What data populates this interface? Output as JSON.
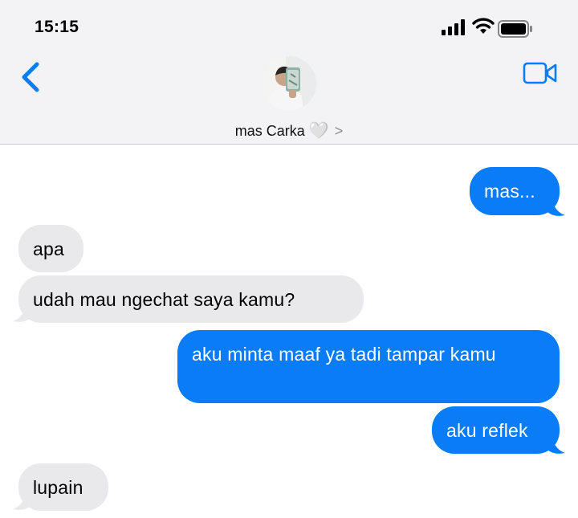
{
  "status_bar": {
    "time": "15:15",
    "icons": [
      "signal-icon",
      "wifi-icon",
      "battery-icon"
    ]
  },
  "header": {
    "back_icon": "chevron-left-icon",
    "contact_name": "mas Carka",
    "contact_emoji": "🤍",
    "contact_chevron": ">",
    "video_icon": "video-camera-icon"
  },
  "colors": {
    "accent": "#0a7cf7",
    "sent_bubble": "#0a7cf7",
    "received_bubble": "#e9e9eb",
    "header_bg": "#f3f3f5"
  },
  "messages": [
    {
      "direction": "sent",
      "text": "mas..."
    },
    {
      "direction": "received",
      "text": "apa"
    },
    {
      "direction": "received",
      "text": "udah mau ngechat saya kamu?"
    },
    {
      "direction": "sent",
      "text": "aku minta maaf ya tadi tampar kamu"
    },
    {
      "direction": "sent",
      "text": "aku reflek"
    },
    {
      "direction": "received",
      "text": "lupain"
    }
  ]
}
